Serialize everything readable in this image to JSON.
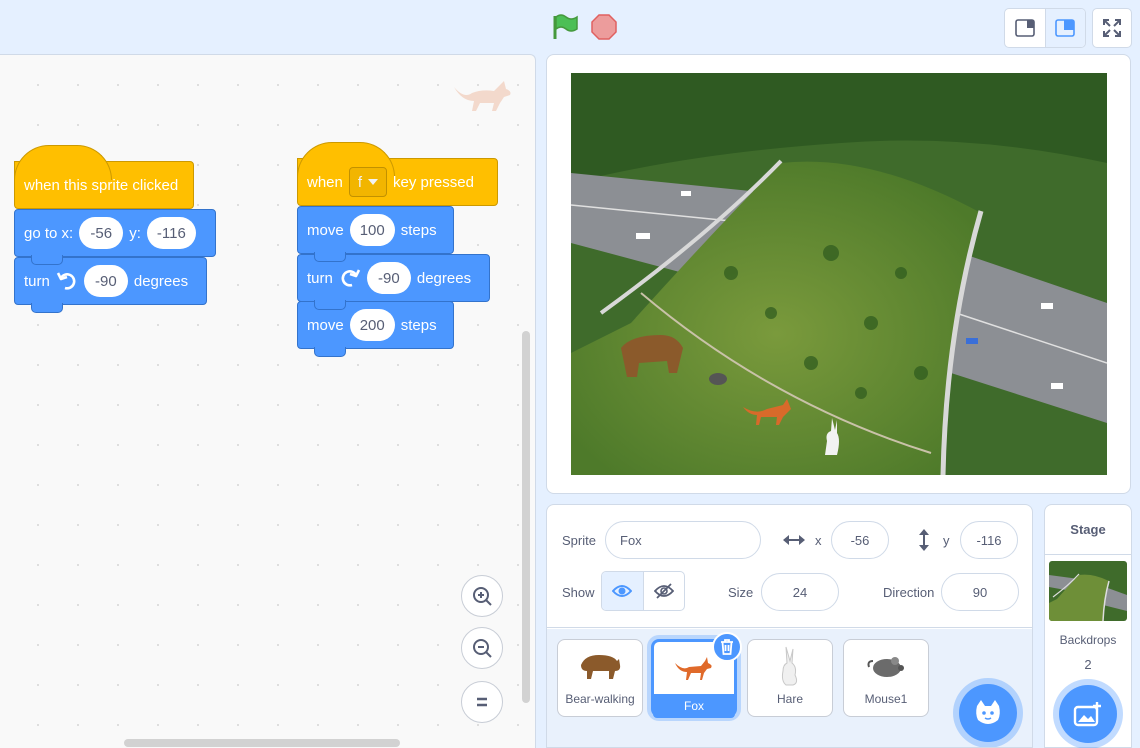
{
  "code_area": {
    "script1": {
      "hat": "when this sprite clicked",
      "goto_label": "go to x:",
      "goto_x": "-56",
      "goto_y_label": "y:",
      "goto_y": "-116",
      "turn_label": "turn",
      "turn_value": "-90",
      "turn_unit": "degrees"
    },
    "script2": {
      "hat_when": "when",
      "hat_key": "f",
      "hat_suffix": "key pressed",
      "move1_label": "move",
      "move1_value": "100",
      "move1_unit": "steps",
      "turn_label": "turn",
      "turn_value": "-90",
      "turn_unit": "degrees",
      "move2_label": "move",
      "move2_value": "200",
      "move2_unit": "steps"
    }
  },
  "sprite_info": {
    "sprite_label": "Sprite",
    "sprite_name": "Fox",
    "x_label": "x",
    "x_value": "-56",
    "y_label": "y",
    "y_value": "-116",
    "show_label": "Show",
    "size_label": "Size",
    "size_value": "24",
    "direction_label": "Direction",
    "direction_value": "90"
  },
  "sprites": [
    {
      "name": "Bear-walking"
    },
    {
      "name": "Fox"
    },
    {
      "name": "Hare"
    },
    {
      "name": "Mouse1"
    }
  ],
  "stage_pane": {
    "title": "Stage",
    "backdrops_label": "Backdrops",
    "backdrops_count": "2"
  },
  "colors": {
    "motion": "#4c97ff",
    "events": "#ffbf00",
    "accent": "#4c97ff",
    "background": "#e5f0ff"
  },
  "icons": [
    "green-flag-icon",
    "stop-icon",
    "small-stage-icon",
    "normal-stage-icon",
    "fullscreen-icon",
    "zoom-in-icon",
    "zoom-out-icon",
    "zoom-reset-icon",
    "visible-eye-icon",
    "hidden-eye-icon",
    "x-arrows-icon",
    "y-arrows-icon",
    "trash-icon",
    "add-sprite-icon",
    "add-backdrop-icon"
  ]
}
